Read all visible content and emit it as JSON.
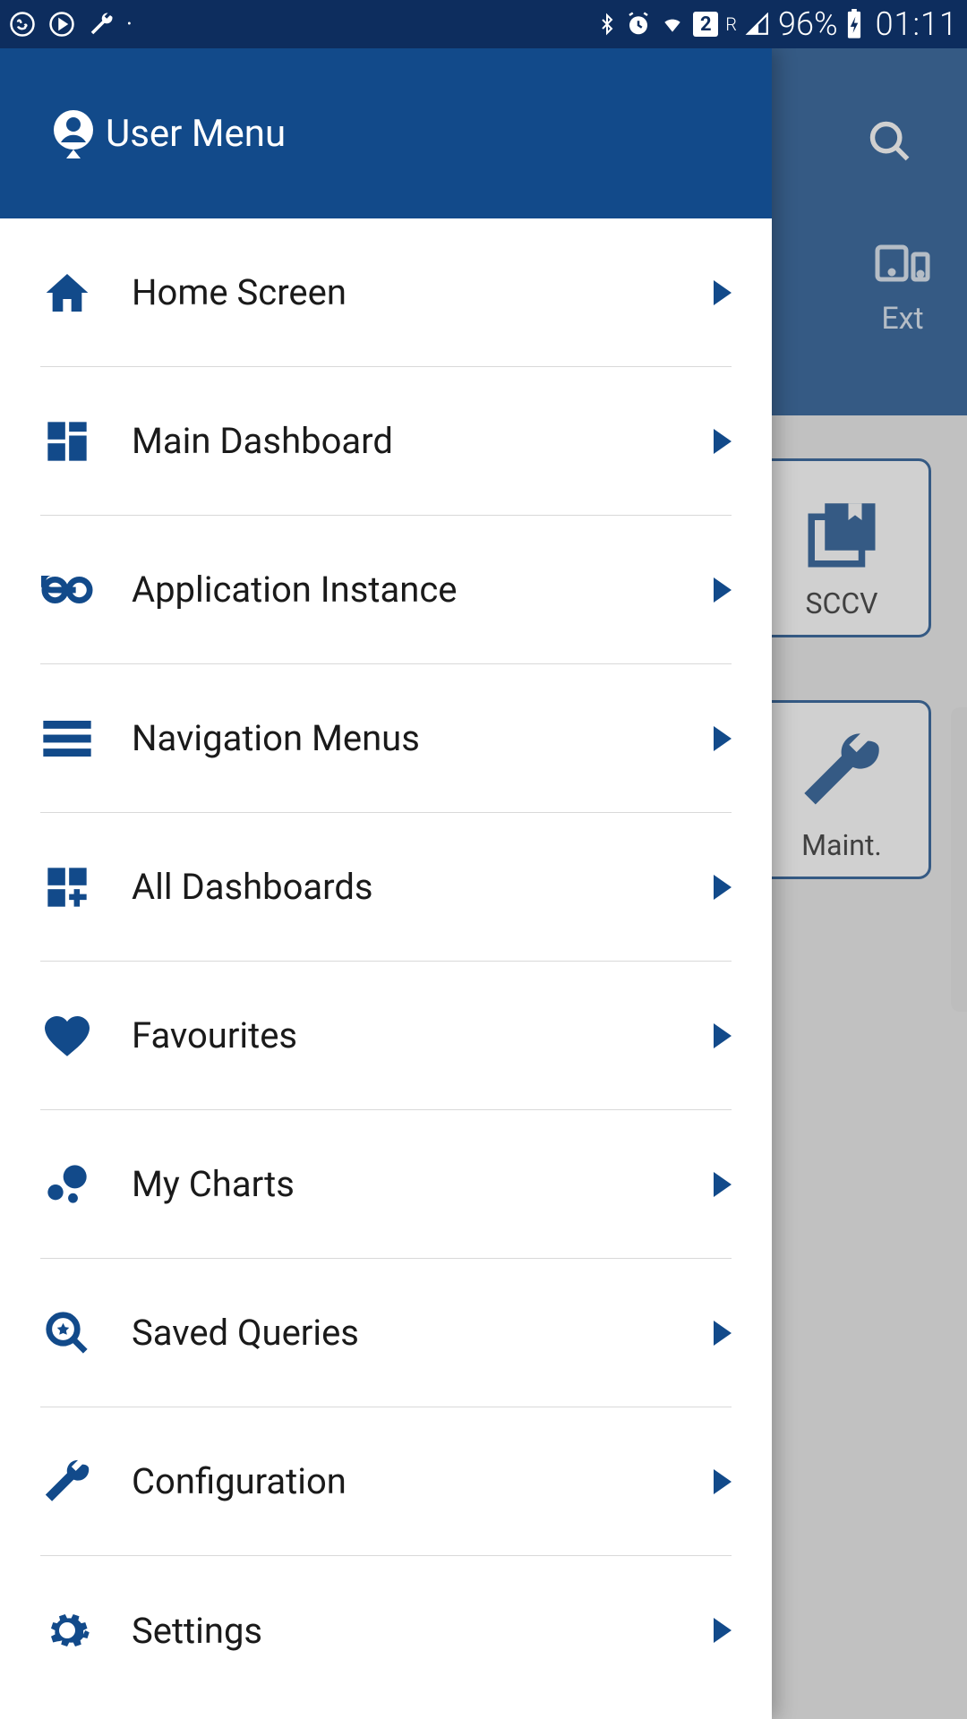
{
  "status": {
    "battery": "96%",
    "time": "01:11"
  },
  "drawer": {
    "title": "User Menu",
    "items": [
      {
        "label": "Home Screen",
        "icon": "home-icon"
      },
      {
        "label": "Main Dashboard",
        "icon": "dashboard-icon"
      },
      {
        "label": "Application Instance",
        "icon": "link-icon"
      },
      {
        "label": "Navigation Menus",
        "icon": "menu-icon"
      },
      {
        "label": "All Dashboards",
        "icon": "dashboard-add-icon"
      },
      {
        "label": "Favourites",
        "icon": "heart-icon"
      },
      {
        "label": "My Charts",
        "icon": "bubble-chart-icon"
      },
      {
        "label": "Saved Queries",
        "icon": "search-star-icon"
      },
      {
        "label": "Configuration",
        "icon": "wrench-icon"
      },
      {
        "label": "Settings",
        "icon": "gear-icon"
      }
    ]
  },
  "background": {
    "ext_label": "Ext",
    "tiles": [
      {
        "label": "SCCV"
      },
      {
        "label": "Maint."
      }
    ]
  }
}
